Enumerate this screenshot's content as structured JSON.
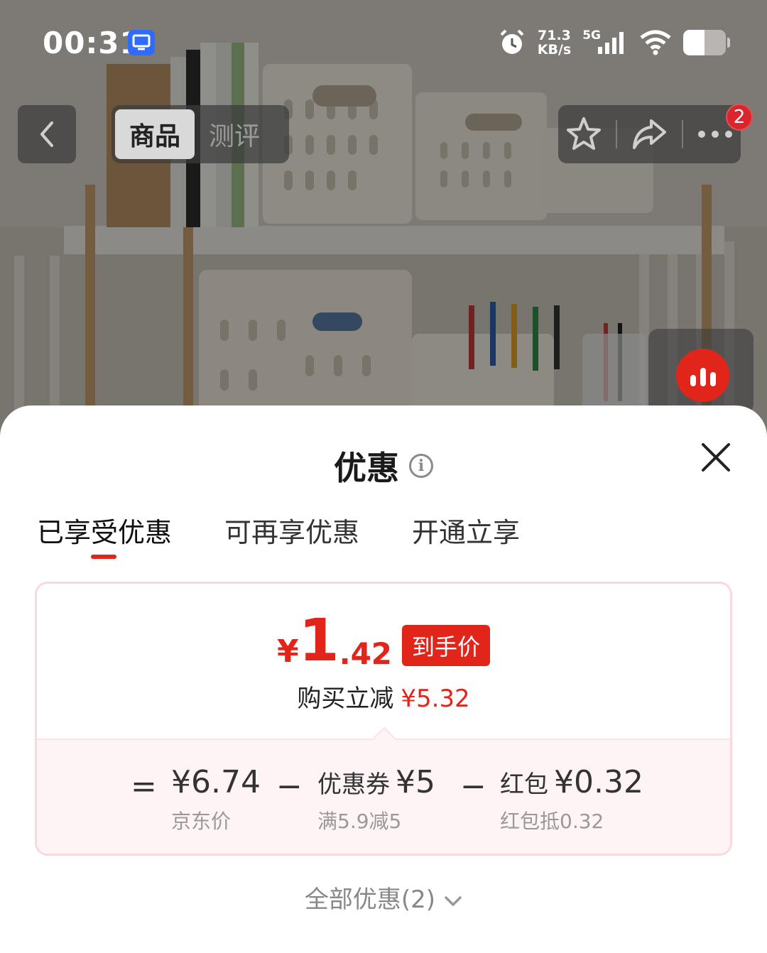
{
  "status_bar": {
    "time": "00:31",
    "net_speed_value": "71.3",
    "net_speed_unit": "KB/s",
    "network_type": "5G",
    "icons": [
      "screen-share-icon",
      "alarm-icon",
      "signal-icon",
      "wifi-icon",
      "battery-icon"
    ]
  },
  "nav": {
    "tabs": [
      {
        "label": "商品",
        "active": true
      },
      {
        "label": "测评",
        "active": false
      }
    ],
    "badge_count": "2",
    "icons": [
      "back-icon",
      "star-icon",
      "share-icon",
      "more-icon"
    ]
  },
  "sheet": {
    "title": "优惠",
    "tabs": [
      {
        "label": "已享受优惠",
        "active": true
      },
      {
        "label": "可再享优惠",
        "active": false
      },
      {
        "label": "开通立享",
        "active": false
      }
    ],
    "final_price": {
      "symbol": "¥",
      "integer": "1",
      "decimal": ".42",
      "tag": "到手价"
    },
    "savings": {
      "label": "购买立减",
      "amount": "¥5.32"
    },
    "breakdown": {
      "equals": "=",
      "minus": "−",
      "base": {
        "value": "¥6.74",
        "sub": "京东价"
      },
      "coupon": {
        "label": "优惠券",
        "value": "¥5",
        "sub": "满5.9减5"
      },
      "red_packet": {
        "label": "红包",
        "value": "¥0.32",
        "sub": "红包抵0.32"
      }
    },
    "all_discounts": "全部优惠(2)"
  },
  "colors": {
    "accent": "#e1251b",
    "card_border": "#fbd7de",
    "breakdown_bg": "#fff4f5"
  }
}
